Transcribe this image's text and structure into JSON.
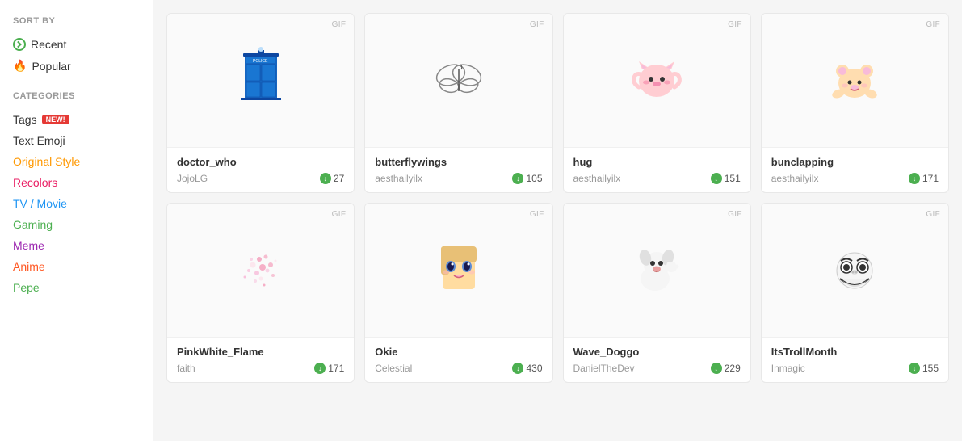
{
  "sidebar": {
    "sort_by_label": "SORT BY",
    "sort_items": [
      {
        "id": "recent",
        "label": "Recent",
        "icon": "recent-icon"
      },
      {
        "id": "popular",
        "label": "Popular",
        "icon": "popular-icon"
      }
    ],
    "categories_label": "CATEGORIES",
    "categories": [
      {
        "id": "tags",
        "label": "Tags",
        "badge": "New!",
        "color": "cat-tags"
      },
      {
        "id": "text-emoji",
        "label": "Text Emoji",
        "color": "cat-text-emoji"
      },
      {
        "id": "original-style",
        "label": "Original Style",
        "color": "cat-original"
      },
      {
        "id": "recolors",
        "label": "Recolors",
        "color": "cat-recolors"
      },
      {
        "id": "tv-movie",
        "label": "TV / Movie",
        "color": "cat-tv"
      },
      {
        "id": "gaming",
        "label": "Gaming",
        "color": "cat-gaming"
      },
      {
        "id": "meme",
        "label": "Meme",
        "color": "cat-meme"
      },
      {
        "id": "anime",
        "label": "Anime",
        "color": "cat-anime"
      },
      {
        "id": "pepe",
        "label": "Pepe",
        "color": "cat-pepe"
      }
    ]
  },
  "cards": [
    {
      "id": "doctor_who",
      "title": "doctor_who",
      "author": "JojoLG",
      "count": "27",
      "badge": "GIF",
      "sticker": "tardis"
    },
    {
      "id": "butterflywings",
      "title": "butterflywings",
      "author": "aesthailyilx",
      "count": "105",
      "badge": "GIF",
      "sticker": "butterflywings"
    },
    {
      "id": "hug",
      "title": "hug",
      "author": "aesthailyilx",
      "count": "151",
      "badge": "GIF",
      "sticker": "hug"
    },
    {
      "id": "bunclapping",
      "title": "bunclapping",
      "author": "aesthailyilx",
      "count": "171",
      "badge": "GIF",
      "sticker": "bunclapping"
    },
    {
      "id": "pinkwhite_flame",
      "title": "PinkWhite_Flame",
      "author": "faith",
      "count": "171",
      "badge": "GIF",
      "sticker": "flame"
    },
    {
      "id": "okie",
      "title": "Okie",
      "author": "Celestial",
      "count": "430",
      "badge": "GIF",
      "sticker": "okie"
    },
    {
      "id": "wave_doggo",
      "title": "Wave_Doggo",
      "author": "DanielTheDev",
      "count": "229",
      "badge": "GIF",
      "sticker": "doggo"
    },
    {
      "id": "itstrollmonth",
      "title": "ItsTrollMonth",
      "author": "Inmagic",
      "count": "155",
      "badge": "GIF",
      "sticker": "troll"
    }
  ]
}
